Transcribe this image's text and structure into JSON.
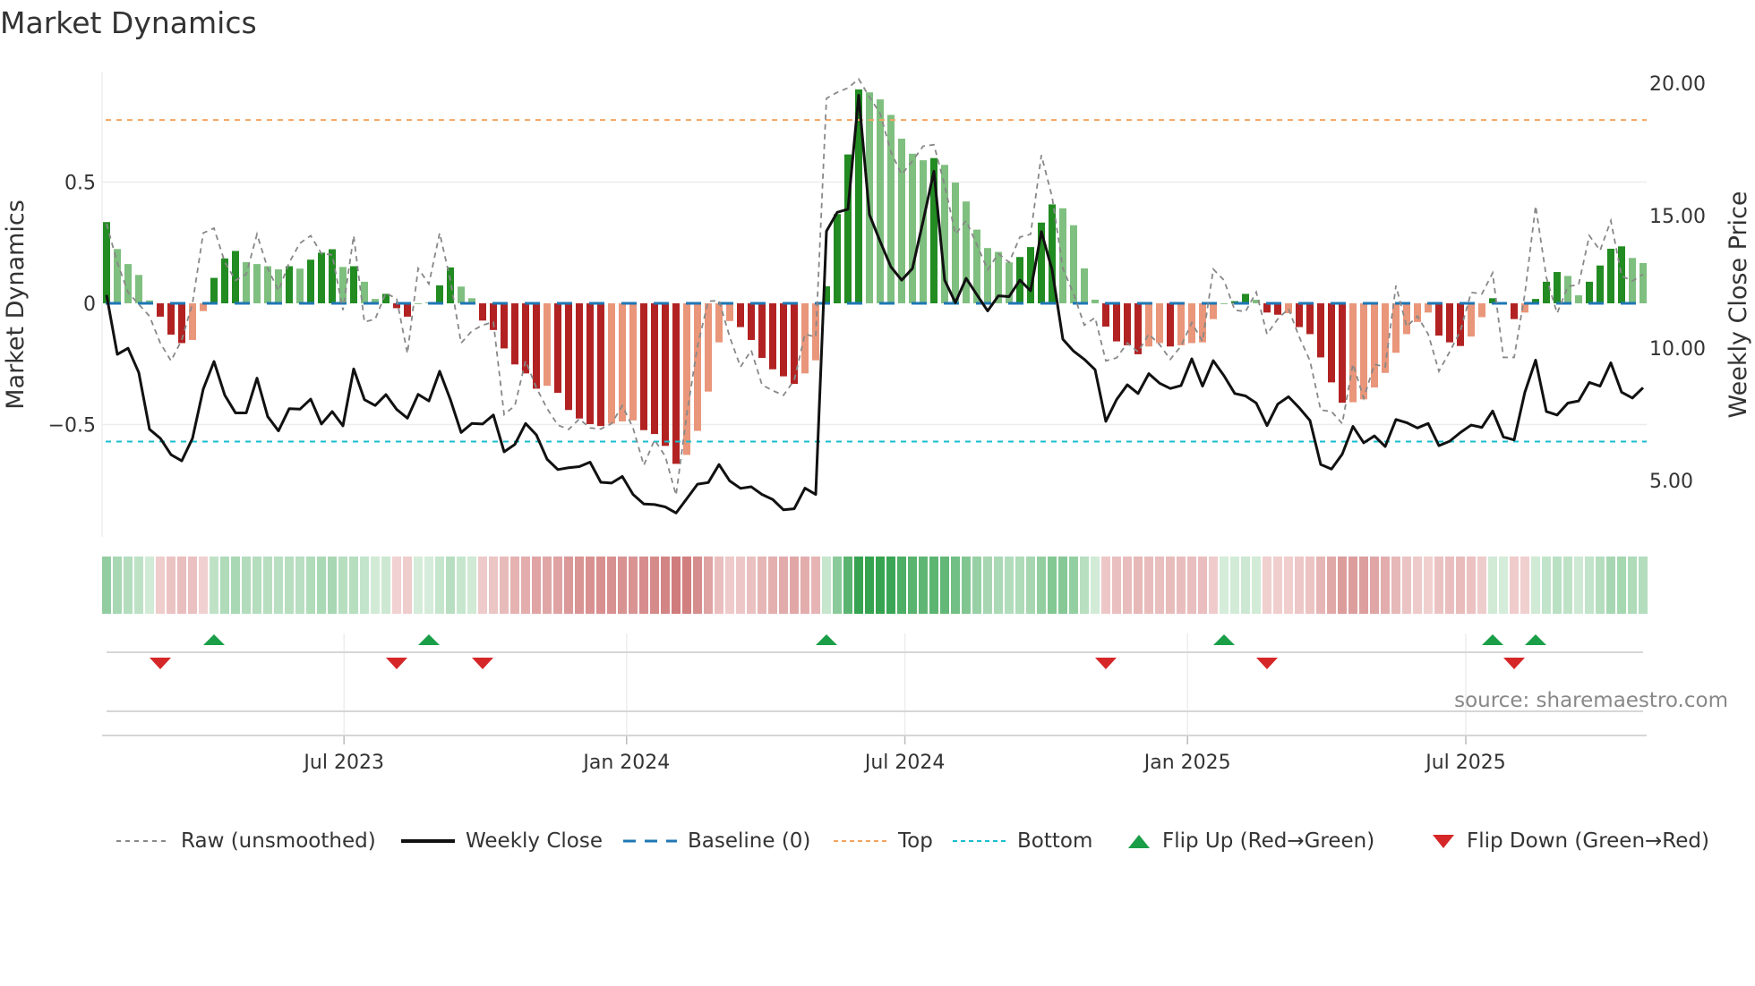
{
  "title": "Market Dynamics",
  "source": "source: sharemaestro.com",
  "colors": {
    "green_dark": "#228b22",
    "green_light": "#7fbf7f",
    "red_dark": "#b22222",
    "red_light": "#e9967a",
    "close": "#111111",
    "raw": "#888888",
    "baseline": "#1f77b4",
    "top": "#f4a460",
    "bottom": "#17becf",
    "flip_up": "#1a9e48",
    "flip_down": "#d62728"
  },
  "legend": [
    {
      "key": "raw",
      "label": "Raw (unsmoothed)"
    },
    {
      "key": "close",
      "label": "Weekly Close"
    },
    {
      "key": "baseline",
      "label": "Baseline (0)"
    },
    {
      "key": "top",
      "label": "Top"
    },
    {
      "key": "bottom",
      "label": "Bottom"
    },
    {
      "key": "flip_up",
      "label": "Flip Up (Red→Green)"
    },
    {
      "key": "flip_down",
      "label": "Flip Down (Green→Red)"
    }
  ],
  "chart_data": {
    "type": "bar",
    "title": "Market Dynamics",
    "ylabel": "Market Dynamics",
    "y2label": "Weekly Close Price",
    "ylim": [
      -0.963,
      0.952
    ],
    "y2lim": [
      2.87,
      20.4
    ],
    "yticks": [
      {
        "v": 0.5,
        "label": "0.5"
      },
      {
        "v": 0,
        "label": "0"
      },
      {
        "v": -0.5,
        "label": "−0.5"
      }
    ],
    "y2ticks": [
      {
        "v": 20,
        "label": "20.00"
      },
      {
        "v": 15,
        "label": "15.00"
      },
      {
        "v": 10,
        "label": "10.00"
      },
      {
        "v": 5,
        "label": "5.00"
      }
    ],
    "xticks": [
      {
        "week": 22.1,
        "label": "Jul 2023"
      },
      {
        "week": 48.4,
        "label": "Jan 2024"
      },
      {
        "week": 74.3,
        "label": "Jul 2024"
      },
      {
        "week": 100.6,
        "label": "Jan 2025"
      },
      {
        "week": 126.5,
        "label": "Jul 2025"
      }
    ],
    "top_level": 0.756,
    "bottom_level": -0.57,
    "baseline": 0,
    "grid": true,
    "legend_position": "bottom",
    "oscillator": [
      0.335,
      0.224,
      0.162,
      0.117,
      0.012,
      -0.055,
      -0.129,
      -0.164,
      -0.151,
      -0.032,
      0.105,
      0.185,
      0.216,
      0.17,
      0.162,
      0.153,
      0.14,
      0.153,
      0.143,
      0.18,
      0.209,
      0.223,
      0.15,
      0.153,
      0.089,
      0.018,
      0.039,
      -0.02,
      -0.055,
      0.0,
      0.002,
      0.074,
      0.148,
      0.069,
      0.021,
      -0.071,
      -0.11,
      -0.186,
      -0.252,
      -0.289,
      -0.352,
      -0.34,
      -0.369,
      -0.44,
      -0.475,
      -0.498,
      -0.506,
      -0.496,
      -0.487,
      -0.483,
      -0.523,
      -0.539,
      -0.588,
      -0.662,
      -0.625,
      -0.526,
      -0.364,
      -0.161,
      -0.073,
      -0.098,
      -0.151,
      -0.225,
      -0.272,
      -0.301,
      -0.332,
      -0.289,
      -0.235,
      0.07,
      0.368,
      0.614,
      0.882,
      0.87,
      0.841,
      0.777,
      0.679,
      0.617,
      0.59,
      0.599,
      0.571,
      0.498,
      0.42,
      0.304,
      0.228,
      0.212,
      0.169,
      0.191,
      0.232,
      0.333,
      0.408,
      0.392,
      0.322,
      0.144,
      0.015,
      -0.096,
      -0.157,
      -0.173,
      -0.21,
      -0.178,
      -0.164,
      -0.178,
      -0.173,
      -0.164,
      -0.161,
      -0.065,
      0.0,
      0.009,
      0.039,
      0.015,
      -0.038,
      -0.047,
      -0.041,
      -0.098,
      -0.127,
      -0.223,
      -0.326,
      -0.41,
      -0.408,
      -0.396,
      -0.347,
      -0.287,
      -0.204,
      -0.127,
      -0.077,
      -0.038,
      -0.133,
      -0.161,
      -0.176,
      -0.137,
      -0.057,
      0.021,
      0.0,
      -0.065,
      -0.038,
      0.018,
      0.089,
      0.129,
      0.113,
      0.033,
      0.089,
      0.156,
      0.225,
      0.235,
      0.187,
      0.166
    ],
    "raw": [
      0.328,
      0.168,
      0.045,
      -0.004,
      -0.053,
      -0.164,
      -0.237,
      -0.151,
      0.0,
      0.29,
      0.31,
      0.17,
      0.095,
      0.12,
      0.285,
      0.144,
      0.052,
      0.168,
      0.248,
      0.279,
      0.205,
      0.2,
      -0.028,
      0.279,
      -0.077,
      -0.065,
      0.043,
      0.018,
      -0.207,
      0.144,
      0.08,
      0.29,
      0.095,
      -0.164,
      -0.114,
      -0.09,
      -0.077,
      -0.459,
      -0.422,
      -0.237,
      -0.348,
      -0.434,
      -0.502,
      -0.52,
      -0.477,
      -0.514,
      -0.518,
      -0.496,
      -0.422,
      -0.514,
      -0.668,
      -0.563,
      -0.631,
      -0.791,
      -0.459,
      -0.176,
      0.009,
      0.011,
      -0.139,
      -0.262,
      -0.194,
      -0.336,
      -0.36,
      -0.379,
      -0.317,
      -0.127,
      -0.139,
      0.845,
      0.87,
      0.888,
      0.925,
      0.851,
      0.783,
      0.624,
      0.531,
      0.587,
      0.648,
      0.654,
      0.488,
      0.285,
      0.341,
      0.242,
      0.138,
      0.205,
      0.169,
      0.273,
      0.285,
      0.611,
      0.439,
      0.144,
      0.039,
      -0.09,
      -0.059,
      -0.237,
      -0.225,
      -0.164,
      -0.2,
      -0.127,
      -0.17,
      -0.231,
      -0.176,
      -0.08,
      -0.157,
      0.141,
      0.095,
      -0.028,
      -0.034,
      0.046,
      -0.127,
      -0.065,
      -0.022,
      -0.139,
      -0.237,
      -0.44,
      -0.446,
      -0.496,
      -0.25,
      -0.391,
      -0.252,
      -0.262,
      0.073,
      -0.096,
      -0.053,
      -0.127,
      -0.28,
      -0.2,
      -0.114,
      0.045,
      0.039,
      0.125,
      -0.223,
      -0.223,
      0.039,
      0.402,
      0.107,
      -0.041,
      0.07,
      0.076,
      0.279,
      0.218,
      0.341,
      0.113,
      0.092,
      0.12
    ],
    "weekly_close": [
      12.0,
      9.76,
      9.99,
      9.07,
      6.93,
      6.59,
      5.97,
      5.74,
      6.59,
      8.45,
      9.49,
      8.22,
      7.55,
      7.55,
      8.86,
      7.41,
      6.87,
      7.71,
      7.69,
      8.07,
      7.13,
      7.6,
      7.06,
      9.21,
      8.05,
      7.83,
      8.24,
      7.68,
      7.35,
      8.25,
      8.0,
      9.12,
      8.05,
      6.81,
      7.15,
      7.13,
      7.47,
      6.08,
      6.36,
      7.15,
      6.72,
      5.8,
      5.41,
      5.48,
      5.52,
      5.69,
      4.93,
      4.9,
      5.15,
      4.47,
      4.11,
      4.09,
      4.0,
      3.77,
      4.31,
      4.86,
      4.92,
      5.6,
      4.98,
      4.7,
      4.76,
      4.47,
      4.28,
      3.89,
      3.93,
      4.71,
      4.47,
      14.41,
      15.12,
      15.24,
      19.54,
      15.03,
      14.02,
      13.06,
      12.56,
      13.0,
      14.8,
      16.67,
      12.56,
      11.71,
      12.63,
      12.01,
      11.4,
      11.97,
      11.94,
      12.56,
      12.16,
      14.39,
      12.95,
      10.33,
      9.88,
      9.57,
      9.18,
      7.23,
      8.05,
      8.61,
      8.28,
      9.03,
      8.67,
      8.47,
      8.58,
      9.59,
      8.56,
      9.52,
      8.95,
      8.28,
      8.19,
      7.92,
      7.07,
      7.88,
      8.16,
      7.74,
      7.26,
      5.6,
      5.43,
      5.99,
      7.04,
      6.42,
      6.68,
      6.28,
      7.3,
      7.18,
      6.98,
      7.15,
      6.31,
      6.48,
      6.81,
      7.09,
      7.0,
      7.62,
      6.64,
      6.53,
      8.33,
      9.54,
      7.6,
      7.47,
      7.92,
      8.0,
      8.7,
      8.56,
      9.44,
      8.33,
      8.11,
      8.5
    ],
    "flip_up_weeks": [
      10,
      30,
      67,
      104,
      129,
      133
    ],
    "flip_down_weeks": [
      5,
      27,
      35,
      93,
      108,
      131
    ]
  }
}
